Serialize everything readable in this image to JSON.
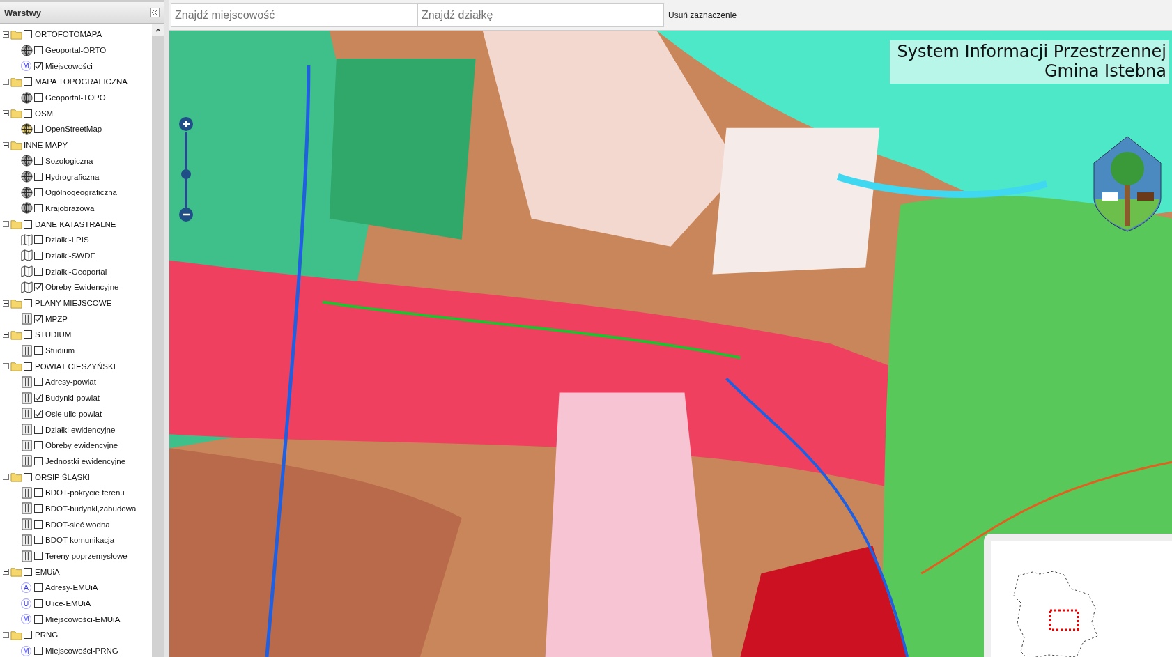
{
  "sidebar": {
    "title": "Warstwy",
    "layers": [
      {
        "label": "ORTOFOTOMAPA",
        "checked": false,
        "expanded": true,
        "children": [
          {
            "label": "Geoportal-ORTO",
            "kind": "globe",
            "checked": false
          },
          {
            "label": "Miejscowości",
            "kind": "letter",
            "badge": "M",
            "checked": true
          }
        ]
      },
      {
        "label": "MAPA TOPOGRAFICZNA",
        "checked": false,
        "expanded": true,
        "children": [
          {
            "label": "Geoportal-TOPO",
            "kind": "globe",
            "checked": false
          }
        ]
      },
      {
        "label": "OSM",
        "checked": false,
        "expanded": true,
        "children": [
          {
            "label": "OpenStreetMap",
            "kind": "osm",
            "checked": false
          }
        ]
      },
      {
        "label": "INNE MAPY",
        "expanded": true,
        "children": [
          {
            "label": "Sozologiczna",
            "kind": "globe",
            "checked": false
          },
          {
            "label": "Hydrograficzna",
            "kind": "globe",
            "checked": false
          },
          {
            "label": "Ogólnogeograficzna",
            "kind": "globe",
            "checked": false
          },
          {
            "label": "Krajobrazowa",
            "kind": "globe",
            "checked": false
          }
        ]
      },
      {
        "label": "DANE KATASTRALNE",
        "checked": false,
        "expanded": true,
        "children": [
          {
            "label": "Działki-LPIS",
            "kind": "map",
            "checked": false
          },
          {
            "label": "Działki-SWDE",
            "kind": "map",
            "checked": false
          },
          {
            "label": "Działki-Geoportal",
            "kind": "map",
            "checked": false
          },
          {
            "label": "Obręby Ewidencyjne",
            "kind": "map",
            "checked": true
          }
        ]
      },
      {
        "label": "PLANY MIEJSCOWE",
        "checked": false,
        "expanded": true,
        "children": [
          {
            "label": "MPZP",
            "kind": "layer",
            "checked": true
          }
        ]
      },
      {
        "label": "STUDIUM",
        "checked": false,
        "expanded": true,
        "children": [
          {
            "label": "Studium",
            "kind": "layer",
            "checked": false
          }
        ]
      },
      {
        "label": "POWIAT CIESZYŃSKI",
        "checked": false,
        "expanded": true,
        "children": [
          {
            "label": "Adresy-powiat",
            "kind": "layer",
            "checked": false
          },
          {
            "label": "Budynki-powiat",
            "kind": "layer",
            "checked": true
          },
          {
            "label": "Osie ulic-powiat",
            "kind": "layer",
            "checked": true
          },
          {
            "label": "Działki ewidencyjne",
            "kind": "layer",
            "checked": false
          },
          {
            "label": "Obręby ewidencyjne",
            "kind": "layer",
            "checked": false
          },
          {
            "label": "Jednostki ewidencyjne",
            "kind": "layer",
            "checked": false
          }
        ]
      },
      {
        "label": "ORSIP ŚLĄSKI",
        "checked": false,
        "expanded": true,
        "children": [
          {
            "label": "BDOT-pokrycie terenu",
            "kind": "layer",
            "checked": false
          },
          {
            "label": "BDOT-budynki,zabudowa",
            "kind": "layer",
            "checked": false
          },
          {
            "label": "BDOT-sieć wodna",
            "kind": "layer",
            "checked": false
          },
          {
            "label": "BDOT-komunikacja",
            "kind": "layer",
            "checked": false
          },
          {
            "label": "Tereny poprzemysłowe",
            "kind": "layer",
            "checked": false
          }
        ]
      },
      {
        "label": "EMUiA",
        "checked": false,
        "expanded": true,
        "children": [
          {
            "label": "Adresy-EMUiA",
            "kind": "letter",
            "badge": "A",
            "checked": false
          },
          {
            "label": "Ulice-EMUiA",
            "kind": "letter",
            "badge": "U",
            "checked": false
          },
          {
            "label": "Miejscowości-EMUiA",
            "kind": "letter",
            "badge": "M",
            "checked": false
          }
        ]
      },
      {
        "label": "PRNG",
        "checked": false,
        "expanded": true,
        "children": [
          {
            "label": "Miejscowości-PRNG",
            "kind": "letter",
            "badge": "M",
            "checked": false
          }
        ]
      }
    ]
  },
  "toolbar": {
    "place_search": {
      "placeholder": "Znajdź miejscowość"
    },
    "parcel_search": {
      "placeholder": "Znajdź działkę"
    },
    "clear_button": "Usuń zaznaczenie"
  },
  "map": {
    "zoom": {
      "level": 0.44
    },
    "title_line_1": "System Informacji Przestrzennej",
    "title_line_2": "Gmina Istebna"
  }
}
